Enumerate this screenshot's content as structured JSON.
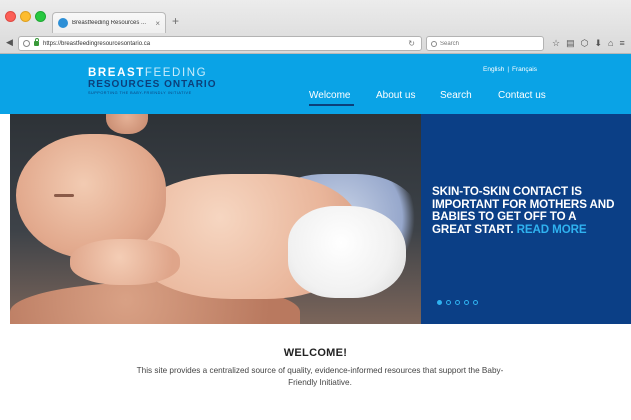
{
  "browser": {
    "tab_title": "Breastfeeding Resources ...",
    "tab_close": "×",
    "new_tab": "+",
    "url": "https://breastfeedingresourcesontario.ca",
    "search_placeholder": "Search"
  },
  "site": {
    "logo": {
      "line1_bold": "BREAST",
      "line1_light": "FEEDING",
      "line2": "RESOURCES ONTARIO",
      "line3": "SUPPORTING THE BABY-FRIENDLY INITIATIVE"
    },
    "lang": {
      "english": "English",
      "separator": "|",
      "french": "Français"
    },
    "nav": [
      {
        "label": "Welcome",
        "active": true
      },
      {
        "label": "About us",
        "active": false
      },
      {
        "label": "Search",
        "active": false
      },
      {
        "label": "Contact us",
        "active": false
      }
    ],
    "hero": {
      "headline": "SKIN-TO-SKIN CONTACT IS IMPORTANT FOR MOTHERS AND BABIES TO GET OFF TO A GREAT START.",
      "read_more": "READ MORE",
      "slides": 5,
      "active_slide": 1
    },
    "welcome": {
      "title": "WELCOME!",
      "body": "This site provides a centralized source of quality, evidence-informed resources that support the Baby-Friendly Initiative."
    }
  },
  "colors": {
    "header_blue": "#0aa3e6",
    "panel_navy": "#0b3f86",
    "accent_cyan": "#2fb2f0"
  }
}
